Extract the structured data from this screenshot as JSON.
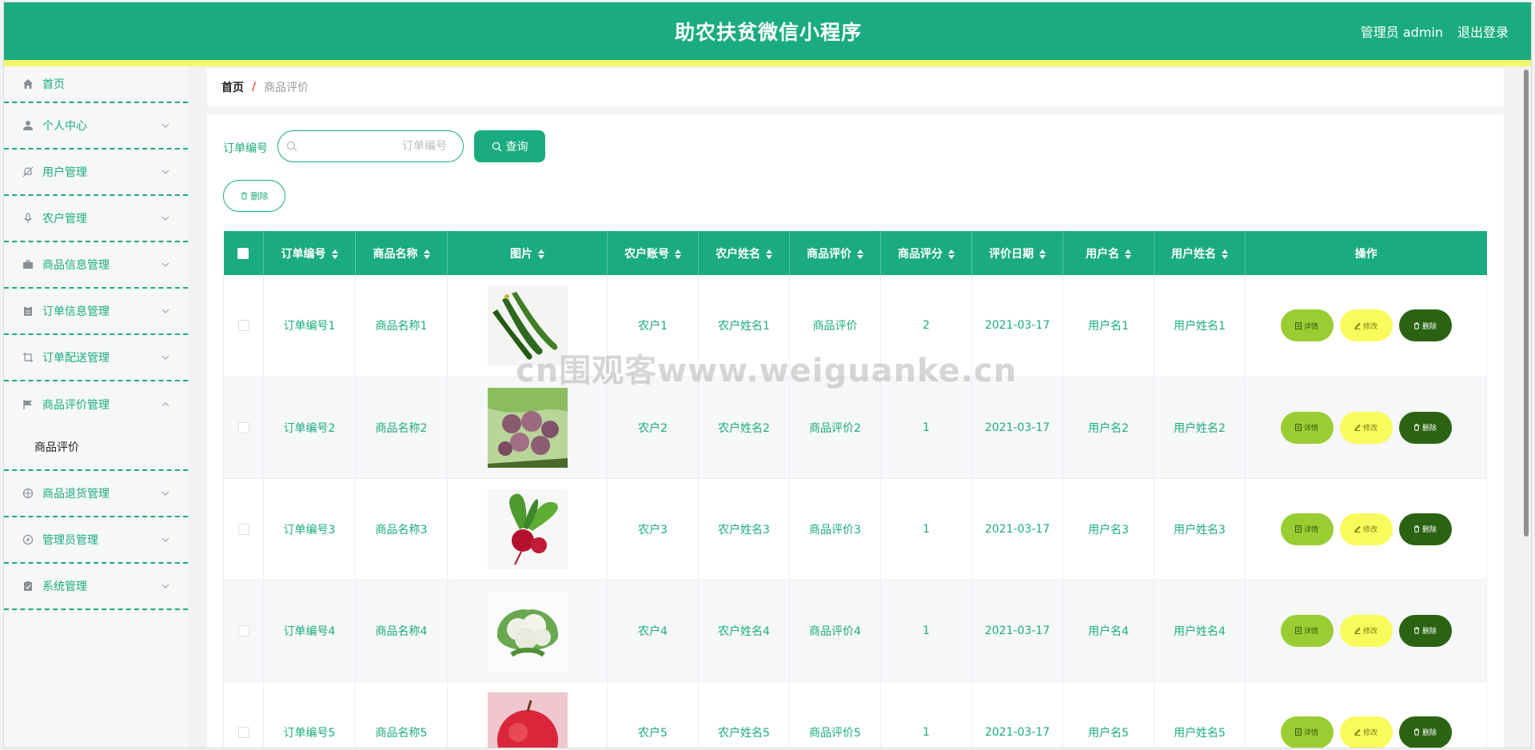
{
  "header": {
    "title": "助农扶贫微信小程序",
    "user": "管理员 admin",
    "logout": "退出登录"
  },
  "sidebar": {
    "items": [
      {
        "label": "首页",
        "icon": "home-icon"
      },
      {
        "label": "个人中心",
        "icon": "user-icon"
      },
      {
        "label": "用户管理",
        "icon": "bell-off-icon"
      },
      {
        "label": "农户管理",
        "icon": "microphone-icon"
      },
      {
        "label": "商品信息管理",
        "icon": "briefcase-icon"
      },
      {
        "label": "订单信息管理",
        "icon": "clipboard-icon"
      },
      {
        "label": "订单配送管理",
        "icon": "crop-icon"
      },
      {
        "label": "商品评价管理",
        "icon": "flag-icon",
        "sub": "商品评价"
      },
      {
        "label": "商品退货管理",
        "icon": "crosshair-icon"
      },
      {
        "label": "管理员管理",
        "icon": "compass-icon"
      },
      {
        "label": "系统管理",
        "icon": "checklist-icon"
      }
    ]
  },
  "breadcrumb": {
    "home": "首页",
    "separator": "/",
    "current": "商品评价"
  },
  "search": {
    "label": "订单编号",
    "placeholder": "订单编号",
    "button": "查询"
  },
  "toolbar": {
    "delete": "删除"
  },
  "table": {
    "headers": [
      "订单编号",
      "商品名称",
      "图片",
      "农户账号",
      "农户姓名",
      "商品评价",
      "商品评分",
      "评价日期",
      "用户名",
      "用户姓名",
      "操作"
    ],
    "rows": [
      {
        "order": "订单编号1",
        "product": "商品名称1",
        "image": "cucumber",
        "farmer_acct": "农户1",
        "farmer_name": "农户姓名1",
        "review": "商品评价",
        "score": "2",
        "date": "2021-03-17",
        "username": "用户名1",
        "user_fullname": "用户姓名1"
      },
      {
        "order": "订单编号2",
        "product": "商品名称2",
        "image": "purple-fruit",
        "farmer_acct": "农户2",
        "farmer_name": "农户姓名2",
        "review": "商品评价2",
        "score": "1",
        "date": "2021-03-17",
        "username": "用户名2",
        "user_fullname": "用户姓名2"
      },
      {
        "order": "订单编号3",
        "product": "商品名称3",
        "image": "beetroot",
        "farmer_acct": "农户3",
        "farmer_name": "农户姓名3",
        "review": "商品评价3",
        "score": "1",
        "date": "2021-03-17",
        "username": "用户名3",
        "user_fullname": "用户姓名3"
      },
      {
        "order": "订单编号4",
        "product": "商品名称4",
        "image": "cauliflower",
        "farmer_acct": "农户4",
        "farmer_name": "农户姓名4",
        "review": "商品评价4",
        "score": "1",
        "date": "2021-03-17",
        "username": "用户名4",
        "user_fullname": "用户姓名4"
      },
      {
        "order": "订单编号5",
        "product": "商品名称5",
        "image": "apple",
        "farmer_acct": "农户5",
        "farmer_name": "农户姓名5",
        "review": "商品评价5",
        "score": "1",
        "date": "2021-03-17",
        "username": "用户名5",
        "user_fullname": "用户姓名5"
      }
    ],
    "actions": {
      "detail": "详情",
      "edit": "修改",
      "delete": "删除"
    }
  },
  "watermark": "cn围观客www.weiguanke.cn",
  "colors": {
    "primary": "#1aac7e",
    "stripe": "#f5f76a",
    "detail_button": "#9acd32",
    "edit_button": "#f8fb5c",
    "delete_button": "#2b6312"
  }
}
